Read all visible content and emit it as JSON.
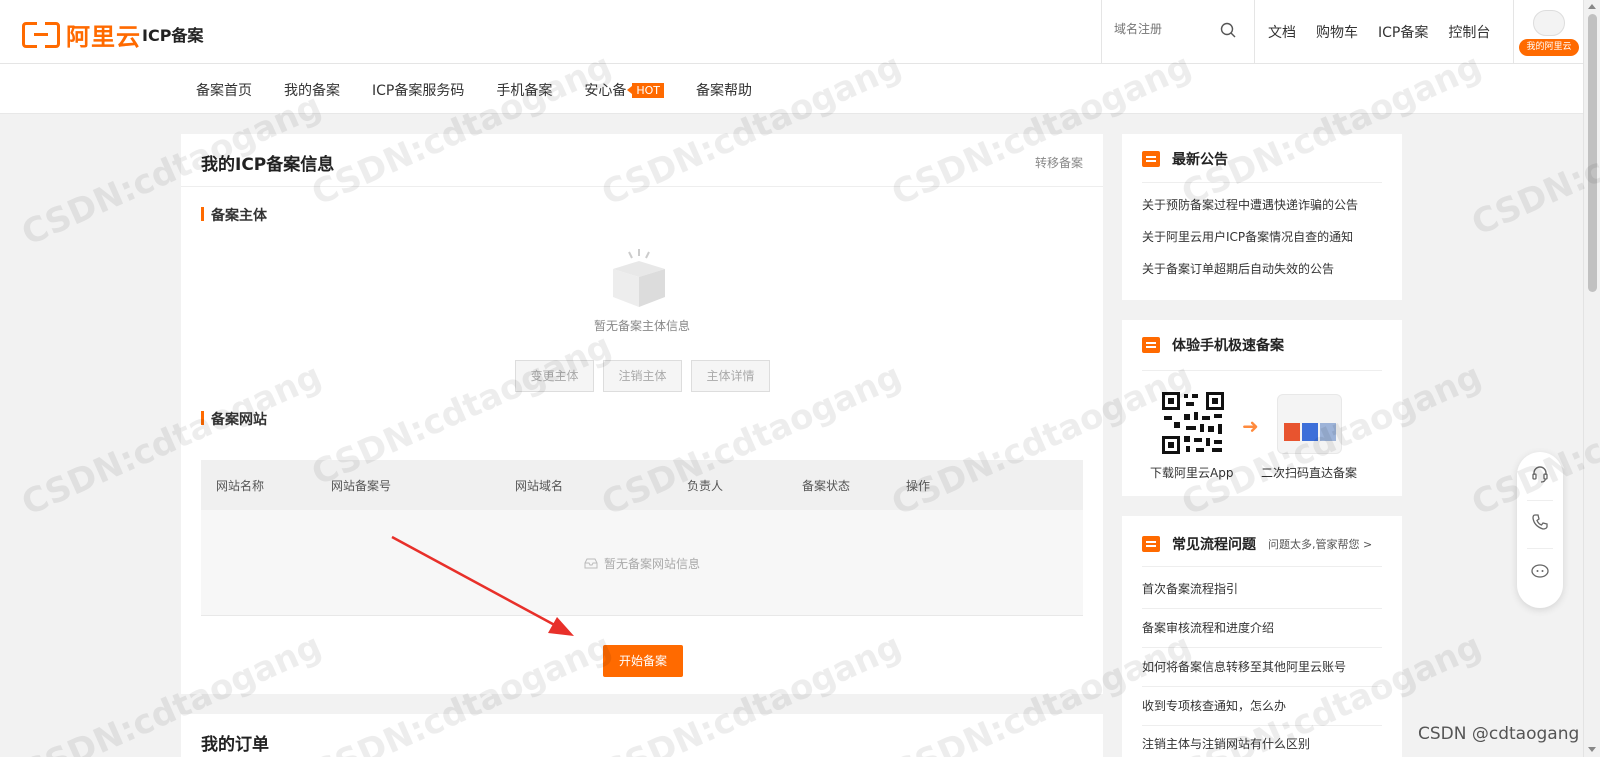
{
  "header": {
    "logo_text": "阿里云",
    "site_title": "ICP备案",
    "search_placeholder": "域名注册",
    "links": [
      "文档",
      "购物车",
      "ICP备案",
      "控制台"
    ],
    "avatar_badge": "我的阿里云"
  },
  "subnav": {
    "items": [
      "备案首页",
      "我的备案",
      "ICP备案服务码",
      "手机备案",
      "安心备",
      "备案帮助"
    ],
    "hot_tag": "HOT"
  },
  "main": {
    "title": "我的ICP备案信息",
    "transfer_link": "转移备案",
    "subject_section": "备案主体",
    "subject_empty": "暂无备案主体信息",
    "subject_buttons": [
      "变更主体",
      "注销主体",
      "主体详情"
    ],
    "website_section": "备案网站",
    "table_columns": [
      "网站名称",
      "网站备案号",
      "网站域名",
      "负责人",
      "备案状态",
      "操作"
    ],
    "website_empty": "暂无备案网站信息",
    "start_button": "开始备案",
    "orders_title": "我的订单"
  },
  "sidebar": {
    "notice_title": "最新公告",
    "notices": [
      "关于预防备案过程中遭遇快递诈骗的公告",
      "关于阿里云用户ICP备案情况自查的通知",
      "关于备案订单超期后自动失效的公告"
    ],
    "mobile_title": "体验手机极速备案",
    "mobile_caption_1": "下载阿里云App",
    "mobile_caption_2": "二次扫码直达备案",
    "faq_title": "常见流程问题",
    "faq_more": "问题太多,管家帮您",
    "faqs": [
      "首次备案流程指引",
      "备案审核流程和进度介绍",
      "如何将备案信息转移至其他阿里云账号",
      "收到专项核查通知，怎么办",
      "注销主体与注销网站有什么区别"
    ]
  },
  "watermark": {
    "text": "CSDN:cdtaogang",
    "corner": "CSDN @cdtaogang"
  },
  "colors": {
    "accent": "#ff6a00"
  }
}
